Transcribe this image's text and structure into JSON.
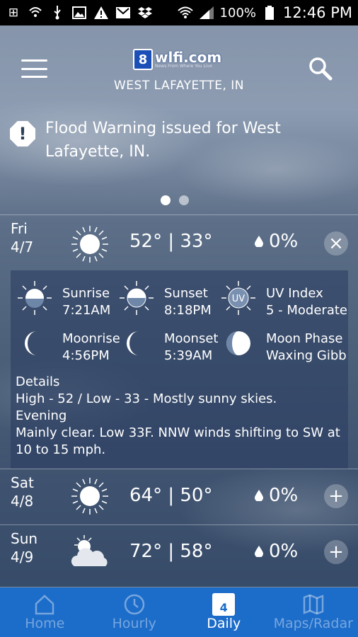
{
  "status_bar": {
    "battery": "100%",
    "time": "12:46 PM"
  },
  "header": {
    "logo_badge": "8",
    "logo_name": "wlfi.com",
    "logo_tagline": "News From Where You Live",
    "location": "WEST LAFAYETTE, IN"
  },
  "alert": {
    "text": "Flood Warning issued for West Lafayette, IN.",
    "pages": 2,
    "active_page": 1
  },
  "days": [
    {
      "day": "Fri",
      "date": "4/7",
      "icon": "sun-icon",
      "temps": "52° | 33°",
      "precip": "0%",
      "expanded": true
    },
    {
      "day": "Sat",
      "date": "4/8",
      "icon": "sun-icon",
      "temps": "64° | 50°",
      "precip": "0%",
      "expanded": false
    },
    {
      "day": "Sun",
      "date": "4/9",
      "icon": "partly-cloudy-icon",
      "temps": "72° | 58°",
      "precip": "0%",
      "expanded": false
    }
  ],
  "detail": {
    "sunrise_label": "Sunrise",
    "sunrise": "7:21AM",
    "sunset_label": "Sunset",
    "sunset": "8:18PM",
    "uv_label": "UV Index",
    "uv": "5 - Moderate",
    "uv_badge": "UV",
    "moonrise_label": "Moonrise",
    "moonrise": "4:56PM",
    "moonset_label": "Moonset",
    "moonset": "5:39AM",
    "moonphase_label": "Moon Phase",
    "moonphase": "Waxing Gibbo",
    "details_title": "Details",
    "details_line1": "High - 52 / Low - 33 - Mostly sunny skies.",
    "details_line2": "Evening",
    "details_line3": "Mainly clear. Low 33F. NNW winds shifting to SW at 10 to 15 mph."
  },
  "nav": [
    {
      "label": "Home"
    },
    {
      "label": "Hourly"
    },
    {
      "label": "Daily",
      "calendar_number": "4"
    },
    {
      "label": "Maps/Radar"
    }
  ],
  "toggle": {
    "collapse": "×",
    "expand": "+"
  }
}
